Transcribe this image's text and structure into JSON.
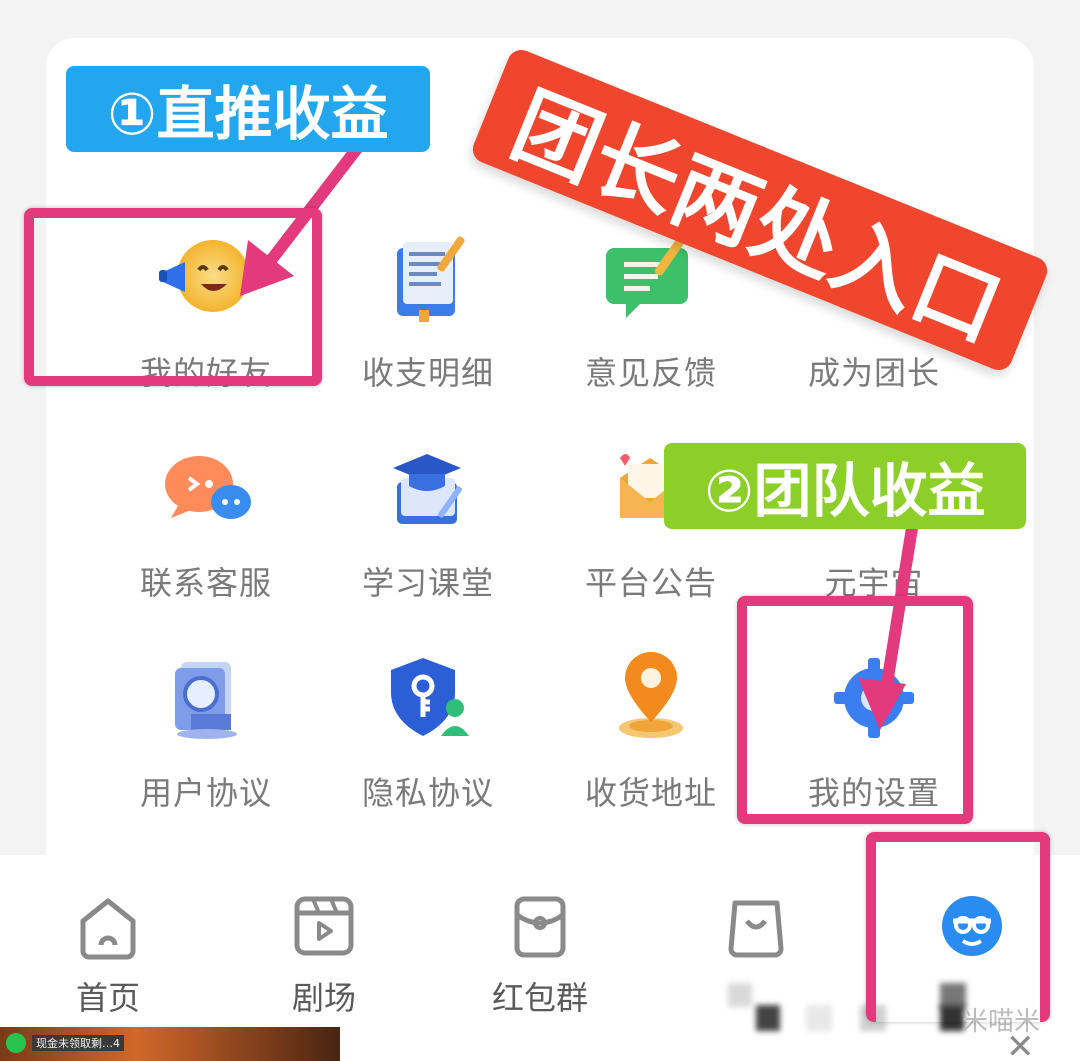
{
  "menu": {
    "items": [
      {
        "label": "我的好友",
        "icon": "megaphone-emoji-icon"
      },
      {
        "label": "收支明细",
        "icon": "ledger-book-icon"
      },
      {
        "label": "意见反馈",
        "icon": "feedback-chat-icon"
      },
      {
        "label": "成为团长",
        "icon": "crown-icon"
      },
      {
        "label": "联系客服",
        "icon": "chat-bubbles-icon"
      },
      {
        "label": "学习课堂",
        "icon": "graduation-notebook-icon"
      },
      {
        "label": "平台公告",
        "icon": "announcement-envelope-icon"
      },
      {
        "label": "元宇宙",
        "icon": "globe-icon"
      },
      {
        "label": "用户协议",
        "icon": "user-agreement-icon"
      },
      {
        "label": "隐私协议",
        "icon": "privacy-shield-key-icon"
      },
      {
        "label": "收货地址",
        "icon": "location-pin-icon"
      },
      {
        "label": "我的设置",
        "icon": "settings-gear-icon"
      }
    ]
  },
  "nav": {
    "items": [
      {
        "label": "首页",
        "icon": "home-icon"
      },
      {
        "label": "剧场",
        "icon": "theater-play-icon"
      },
      {
        "label": "红包群",
        "icon": "red-envelope-icon"
      },
      {
        "label": "",
        "icon": "shopping-bag-icon"
      },
      {
        "label": "",
        "icon": "profile-avatar-icon"
      }
    ],
    "mine_label_partial": "米喵米"
  },
  "annotations": {
    "banner": "团长两处入口",
    "tag1": "①直推收益",
    "tag2": "②团队收益"
  },
  "ad": {
    "snippet": "现金未领取剩…4"
  },
  "colors": {
    "highlight_box": "#e23a7c",
    "banner_bg": "#f0462e",
    "tag1_bg": "#22a6ee",
    "tag2_bg": "#8ccf28",
    "profile_accent": "#2a8cf0"
  }
}
